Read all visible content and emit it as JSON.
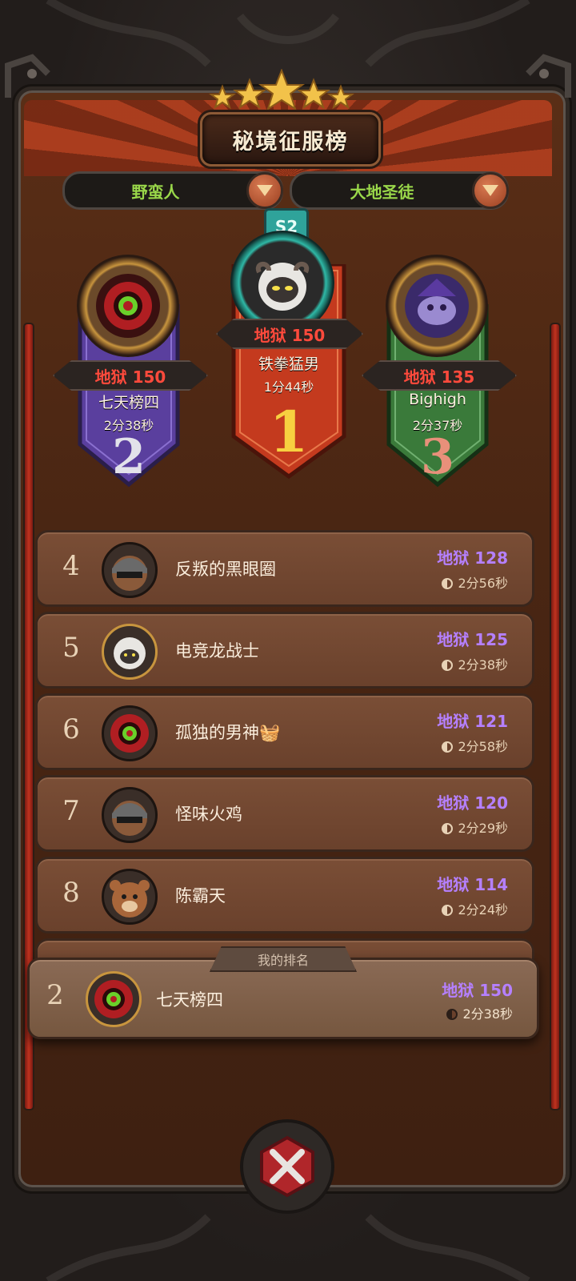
{
  "header": {
    "title": "秘境征服榜"
  },
  "filters": {
    "class_label": "野蛮人",
    "spec_label": "大地圣徒"
  },
  "season_badge": "S2",
  "podium": [
    {
      "rank": "1",
      "level": "地狱 150",
      "name": "铁拳猛男",
      "time": "1分44秒",
      "color": "#c43a1e"
    },
    {
      "rank": "2",
      "level": "地狱 150",
      "name": "七天榜四",
      "time": "2分38秒",
      "color": "#5a3f9e"
    },
    {
      "rank": "3",
      "level": "地狱 135",
      "name": "Bighigh",
      "time": "2分37秒",
      "color": "#3a7a3a"
    }
  ],
  "list": [
    {
      "rank": "4",
      "name": "反叛的黑眼圈",
      "level": "地狱 128",
      "time": "2分56秒"
    },
    {
      "rank": "5",
      "name": "电竞龙战士",
      "level": "地狱 125",
      "time": "2分38秒"
    },
    {
      "rank": "6",
      "name": "孤独的男神🧺",
      "level": "地狱 121",
      "time": "2分58秒"
    },
    {
      "rank": "7",
      "name": "怪味火鸡",
      "level": "地狱 120",
      "time": "2分29秒"
    },
    {
      "rank": "8",
      "name": "陈霸天",
      "level": "地狱 114",
      "time": "2分24秒"
    }
  ],
  "my_rank": {
    "label": "我的排名",
    "rank": "2",
    "name": "七天榜四",
    "level": "地狱 150",
    "time": "2分38秒"
  }
}
